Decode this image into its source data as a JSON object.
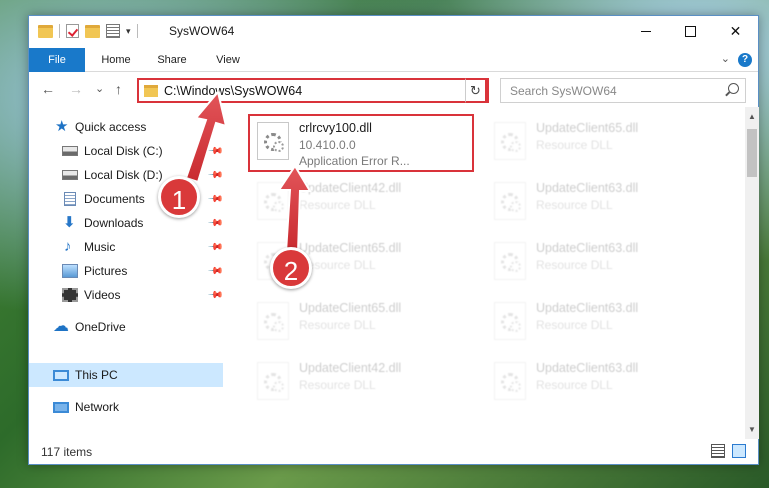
{
  "window": {
    "title": "SysWOW64",
    "quick_access_dropdown": "▾",
    "controls": {
      "close": "✕"
    }
  },
  "ribbon": {
    "tabs": [
      "File",
      "Home",
      "Share",
      "View"
    ],
    "help": "?",
    "expand": "⌄"
  },
  "navigation": {
    "back": "←",
    "forward": "→",
    "recent": "⌄",
    "up": "↑",
    "address": "C:\\Windows\\SysWOW64",
    "address_dropdown": "⌄",
    "refresh": "↻",
    "search_placeholder": "Search SysWOW64"
  },
  "sidebar": {
    "items": [
      {
        "label": "Quick access",
        "icon": "quick-access-star-icon",
        "pinned": false
      },
      {
        "label": "Local Disk (C:)",
        "icon": "local-disk-icon",
        "pinned": true
      },
      {
        "label": "Local Disk (D:)",
        "icon": "local-disk-icon",
        "pinned": true
      },
      {
        "label": "Documents",
        "icon": "documents-icon",
        "pinned": true
      },
      {
        "label": "Downloads",
        "icon": "downloads-icon",
        "pinned": true
      },
      {
        "label": "Music",
        "icon": "music-icon",
        "pinned": true
      },
      {
        "label": "Pictures",
        "icon": "pictures-icon",
        "pinned": true
      },
      {
        "label": "Videos",
        "icon": "videos-icon",
        "pinned": true
      },
      {
        "label": "OneDrive",
        "icon": "onedrive-icon",
        "pinned": false
      },
      {
        "label": "This PC",
        "icon": "this-pc-icon",
        "pinned": false,
        "selected": true
      },
      {
        "label": "Network",
        "icon": "network-icon",
        "pinned": false
      }
    ],
    "pin_glyph": "📌"
  },
  "files": {
    "highlighted": {
      "name": "crlrcvy100.dll",
      "version": "10.410.0.0",
      "description": "Application Error R..."
    },
    "left_column": [
      {
        "name": "UpdateClient42.dll",
        "type": "Resource DLL"
      },
      {
        "name": "UpdateClient65.dll",
        "type": "Resource DLL"
      },
      {
        "name": "UpdateClient65.dll",
        "type": "Resource DLL"
      },
      {
        "name": "UpdateClient42.dll",
        "type": "Resource DLL"
      }
    ],
    "right_column": [
      {
        "name": "UpdateClient65.dll",
        "type": "Resource DLL"
      },
      {
        "name": "UpdateClient63.dll",
        "type": "Resource DLL"
      },
      {
        "name": "UpdateClient63.dll",
        "type": "Resource DLL"
      },
      {
        "name": "UpdateClient63.dll",
        "type": "Resource DLL"
      },
      {
        "name": "UpdateClient63.dll",
        "type": "Resource DLL"
      }
    ]
  },
  "status": {
    "item_count": "117 items"
  },
  "annotations": {
    "step1": "1",
    "step2": "2",
    "color": "#d9393a"
  },
  "colors": {
    "accent": "#1979ca",
    "highlight": "#d9333a",
    "selected_bg": "#cce8ff"
  }
}
